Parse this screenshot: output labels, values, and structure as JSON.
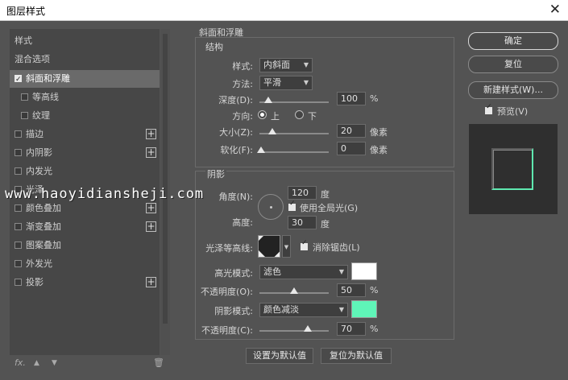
{
  "window": {
    "title": "图层样式",
    "close_glyph": "✕"
  },
  "sidebar": {
    "header": "样式",
    "blend": "混合选项",
    "items": [
      {
        "label": "斜面和浮雕",
        "checked": true,
        "plus": false,
        "selected": true
      },
      {
        "label": "等高线",
        "checked": false,
        "plus": false
      },
      {
        "label": "纹理",
        "checked": false,
        "plus": false
      },
      {
        "label": "描边",
        "checked": false,
        "plus": true
      },
      {
        "label": "内阴影",
        "checked": false,
        "plus": true
      },
      {
        "label": "内发光",
        "checked": false,
        "plus": false
      },
      {
        "label": "光泽",
        "checked": false,
        "plus": false
      },
      {
        "label": "颜色叠加",
        "checked": false,
        "plus": true
      },
      {
        "label": "渐变叠加",
        "checked": false,
        "plus": true
      },
      {
        "label": "图案叠加",
        "checked": false,
        "plus": false
      },
      {
        "label": "外发光",
        "checked": false,
        "plus": false
      },
      {
        "label": "投影",
        "checked": false,
        "plus": true
      }
    ],
    "plus_glyph": "+",
    "bottom": {
      "fx": "fx.",
      "up": "▲",
      "down": "▼",
      "trash": "🗑"
    }
  },
  "bevel": {
    "title": "斜面和浮雕",
    "structure": {
      "title": "结构",
      "style_label": "样式:",
      "style_value": "内斜面",
      "method_label": "方法:",
      "method_value": "平滑",
      "depth_label": "深度(D):",
      "depth_value": "100",
      "depth_unit": "%",
      "direction_label": "方向:",
      "up_label": "上",
      "down_label": "下",
      "size_label": "大小(Z):",
      "size_value": "20",
      "size_unit": "像素",
      "soften_label": "软化(F):",
      "soften_value": "0",
      "soften_unit": "像素"
    },
    "shading": {
      "title": "阴影",
      "angle_label": "角度(N):",
      "angle_value": "120",
      "angle_unit": "度",
      "global_light_label": "使用全局光(G)",
      "altitude_label": "高度:",
      "altitude_value": "30",
      "altitude_unit": "度",
      "gloss_label": "光泽等高线:",
      "antialias_label": "消除锯齿(L)",
      "highlight_mode_label": "高光模式:",
      "highlight_mode_value": "滤色",
      "highlight_color": "#ffffff",
      "highlight_opacity_label": "不透明度(O):",
      "highlight_opacity_value": "50",
      "highlight_opacity_unit": "%",
      "shadow_mode_label": "阴影模式:",
      "shadow_mode_value": "颜色减淡",
      "shadow_color": "#5ff5b8",
      "shadow_opacity_label": "不透明度(C):",
      "shadow_opacity_value": "70",
      "shadow_opacity_unit": "%"
    },
    "make_default": "设置为默认值",
    "reset_default": "复位为默认值"
  },
  "buttons": {
    "ok": "确定",
    "reset": "复位",
    "new_style": "新建样式(W)...",
    "preview": "预览(V)"
  },
  "watermark": "www.haoyidiansheji.com"
}
